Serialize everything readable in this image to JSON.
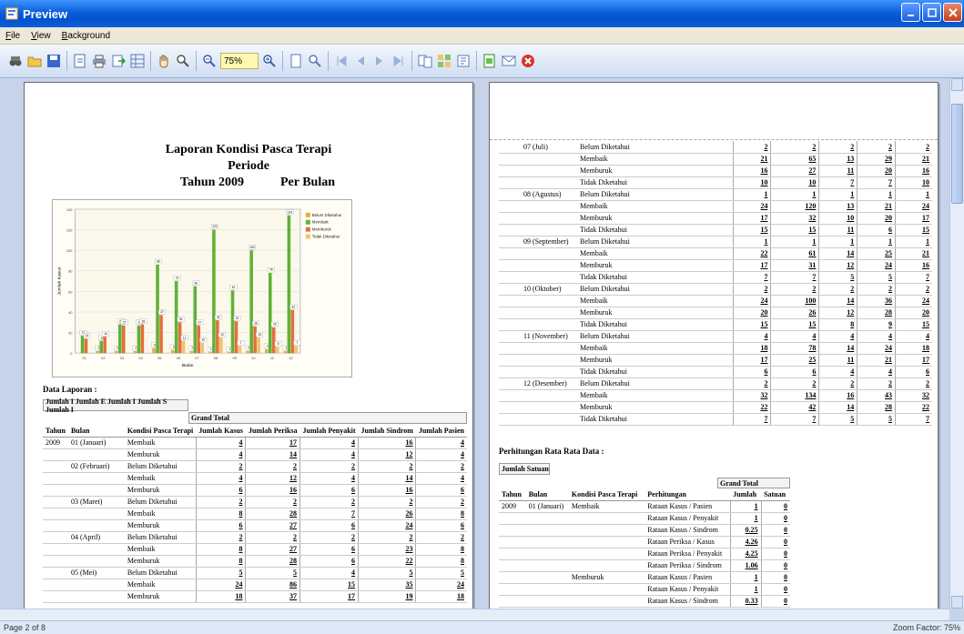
{
  "window": {
    "title": "Preview"
  },
  "menu": [
    "File",
    "View",
    "Background"
  ],
  "toolbar": {
    "zoom": "75%"
  },
  "status": {
    "page": "Page 2 of 8",
    "zoom": "Zoom Factor: 75%"
  },
  "report": {
    "title_line1": "Laporan Kondisi Pasca Terapi",
    "title_line2": "Periode",
    "title_year": "Tahun 2009",
    "title_per": "Per Bulan",
    "data_section": "Data Laporan :",
    "field_strip": "Jumlah I Jumlah E Jumlah I Jumlah S Jumlah I",
    "grand_total": "Grand Total",
    "columns": [
      "Tahun",
      "Bulan",
      "Kondisi Pasca Terapi",
      "Jumlah Kasus",
      "Jumlah Periksa",
      "Jumlah Penyakit",
      "Jumlah Sindrom",
      "Jumlah Pasien"
    ],
    "year": "2009",
    "rows": [
      {
        "month": "01 (Januari)",
        "kondisi": "Membaik",
        "v": [
          "4",
          "17",
          "4",
          "16",
          "4"
        ]
      },
      {
        "month": "",
        "kondisi": "Memburuk",
        "v": [
          "4",
          "14",
          "4",
          "12",
          "4"
        ]
      },
      {
        "month": "02 (Februari)",
        "kondisi": "Belum Diketahui",
        "v": [
          "2",
          "2",
          "2",
          "2",
          "2"
        ]
      },
      {
        "month": "",
        "kondisi": "Membaik",
        "v": [
          "4",
          "12",
          "4",
          "14",
          "4"
        ]
      },
      {
        "month": "",
        "kondisi": "Memburuk",
        "v": [
          "6",
          "16",
          "6",
          "16",
          "6"
        ]
      },
      {
        "month": "03 (Maret)",
        "kondisi": "Belum Diketahui",
        "v": [
          "2",
          "2",
          "2",
          "2",
          "2"
        ]
      },
      {
        "month": "",
        "kondisi": "Membaik",
        "v": [
          "8",
          "28",
          "7",
          "26",
          "8"
        ]
      },
      {
        "month": "",
        "kondisi": "Memburuk",
        "v": [
          "6",
          "27",
          "6",
          "24",
          "6"
        ]
      },
      {
        "month": "04 (April)",
        "kondisi": "Belum Diketahui",
        "v": [
          "2",
          "2",
          "2",
          "2",
          "2"
        ]
      },
      {
        "month": "",
        "kondisi": "Membaik",
        "v": [
          "8",
          "27",
          "6",
          "23",
          "8"
        ]
      },
      {
        "month": "",
        "kondisi": "Memburuk",
        "v": [
          "8",
          "28",
          "6",
          "22",
          "8"
        ]
      },
      {
        "month": "05 (Mei)",
        "kondisi": "Belum Diketahui",
        "v": [
          "5",
          "5",
          "4",
          "5",
          "5"
        ]
      },
      {
        "month": "",
        "kondisi": "Membaik",
        "v": [
          "24",
          "86",
          "15",
          "35",
          "24"
        ]
      },
      {
        "month": "",
        "kondisi": "Memburuk",
        "v": [
          "18",
          "37",
          "17",
          "19",
          "18"
        ]
      }
    ],
    "rows2": [
      {
        "month": "07 (Juli)",
        "kondisi": "Belum Diketahui",
        "v": [
          "2",
          "2",
          "2",
          "2",
          "2"
        ]
      },
      {
        "month": "",
        "kondisi": "Membaik",
        "v": [
          "21",
          "65",
          "13",
          "29",
          "21"
        ]
      },
      {
        "month": "",
        "kondisi": "Memburuk",
        "v": [
          "16",
          "27",
          "11",
          "20",
          "16"
        ]
      },
      {
        "month": "",
        "kondisi": "Tidak Diketahui",
        "v": [
          "10",
          "10",
          "7",
          "7",
          "10"
        ]
      },
      {
        "month": "08 (Agustus)",
        "kondisi": "Belum Diketahui",
        "v": [
          "1",
          "1",
          "1",
          "1",
          "1"
        ]
      },
      {
        "month": "",
        "kondisi": "Membaik",
        "v": [
          "24",
          "120",
          "13",
          "21",
          "24"
        ]
      },
      {
        "month": "",
        "kondisi": "Memburuk",
        "v": [
          "17",
          "32",
          "10",
          "20",
          "17"
        ]
      },
      {
        "month": "",
        "kondisi": "Tidak Diketahui",
        "v": [
          "15",
          "15",
          "11",
          "6",
          "15"
        ]
      },
      {
        "month": "09 (September)",
        "kondisi": "Belum Diketahui",
        "v": [
          "1",
          "1",
          "1",
          "1",
          "1"
        ]
      },
      {
        "month": "",
        "kondisi": "Membaik",
        "v": [
          "22",
          "61",
          "14",
          "25",
          "21"
        ]
      },
      {
        "month": "",
        "kondisi": "Memburuk",
        "v": [
          "17",
          "31",
          "12",
          "24",
          "16"
        ]
      },
      {
        "month": "",
        "kondisi": "Tidak Diketahui",
        "v": [
          "7",
          "7",
          "5",
          "5",
          "7"
        ]
      },
      {
        "month": "10 (Oktober)",
        "kondisi": "Belum Diketahui",
        "v": [
          "2",
          "2",
          "2",
          "2",
          "2"
        ]
      },
      {
        "month": "",
        "kondisi": "Membaik",
        "v": [
          "24",
          "100",
          "14",
          "36",
          "24"
        ]
      },
      {
        "month": "",
        "kondisi": "Memburuk",
        "v": [
          "20",
          "26",
          "12",
          "28",
          "20"
        ]
      },
      {
        "month": "",
        "kondisi": "Tidak Diketahui",
        "v": [
          "15",
          "15",
          "8",
          "9",
          "15"
        ]
      },
      {
        "month": "11 (November)",
        "kondisi": "Belum Diketahui",
        "v": [
          "4",
          "4",
          "4",
          "4",
          "4"
        ]
      },
      {
        "month": "",
        "kondisi": "Membaik",
        "v": [
          "18",
          "78",
          "14",
          "24",
          "18"
        ]
      },
      {
        "month": "",
        "kondisi": "Memburuk",
        "v": [
          "17",
          "25",
          "11",
          "21",
          "17"
        ]
      },
      {
        "month": "",
        "kondisi": "Tidak Diketahui",
        "v": [
          "6",
          "6",
          "4",
          "4",
          "6"
        ]
      },
      {
        "month": "12 (Desember)",
        "kondisi": "Belum Diketahui",
        "v": [
          "2",
          "2",
          "2",
          "2",
          "2"
        ]
      },
      {
        "month": "",
        "kondisi": "Membaik",
        "v": [
          "32",
          "134",
          "16",
          "43",
          "32"
        ]
      },
      {
        "month": "",
        "kondisi": "Memburuk",
        "v": [
          "22",
          "42",
          "14",
          "28",
          "22"
        ]
      },
      {
        "month": "",
        "kondisi": "Tidak Diketahui",
        "v": [
          "7",
          "7",
          "5",
          "5",
          "7"
        ]
      }
    ],
    "calc_section": "Perhitungan Rata Rata Data :",
    "calc_strip": "Jumlah  Satuan",
    "calc_columns": [
      "Tahun",
      "Bulan",
      "Kondisi Pasca Terapi",
      "Perhitungan",
      "Jumlah",
      "Satuan"
    ],
    "calc_rows": [
      {
        "year": "2009",
        "month": "01 (Januari)",
        "kondisi": "Membaik",
        "label": "Rataan Kasus / Pasien",
        "jumlah": "1",
        "satuan": "0"
      },
      {
        "year": "",
        "month": "",
        "kondisi": "",
        "label": "Rataan Kasus / Penyakit",
        "jumlah": "1",
        "satuan": "0"
      },
      {
        "year": "",
        "month": "",
        "kondisi": "",
        "label": "Rataan Kasus / Sindrom",
        "jumlah": "0.25",
        "satuan": "0"
      },
      {
        "year": "",
        "month": "",
        "kondisi": "",
        "label": "Rataan Periksa / Kasus",
        "jumlah": "4.26",
        "satuan": "0"
      },
      {
        "year": "",
        "month": "",
        "kondisi": "",
        "label": "Rataan Periksa / Penyakit",
        "jumlah": "4.25",
        "satuan": "0"
      },
      {
        "year": "",
        "month": "",
        "kondisi": "",
        "label": "Rataan Periksa / Sindrom",
        "jumlah": "1.06",
        "satuan": "0"
      },
      {
        "year": "",
        "month": "",
        "kondisi": "Memburuk",
        "label": "Rataan Kasus / Pasien",
        "jumlah": "1",
        "satuan": "0"
      },
      {
        "year": "",
        "month": "",
        "kondisi": "",
        "label": "Rataan Kasus / Penyakit",
        "jumlah": "1",
        "satuan": "0"
      },
      {
        "year": "",
        "month": "",
        "kondisi": "",
        "label": "Rataan Kasus / Sindrom",
        "jumlah": "0.33",
        "satuan": "0"
      }
    ]
  },
  "chart_data": {
    "type": "bar",
    "ylabel": "Jumlah Kasus",
    "xlabel": "Bulan",
    "legend_position": "top-right",
    "ylim": [
      0,
      140
    ],
    "categories": [
      "01",
      "02",
      "03",
      "04",
      "05",
      "06",
      "07",
      "08",
      "09",
      "10",
      "11",
      "12"
    ],
    "series": [
      {
        "name": "Belum Diketahui",
        "color": "#e8a94a",
        "values": [
          0,
          2,
          2,
          2,
          5,
          3,
          2,
          1,
          1,
          2,
          4,
          2
        ]
      },
      {
        "name": "Membaik",
        "color": "#5fb236",
        "values": [
          17,
          12,
          28,
          27,
          86,
          70,
          65,
          120,
          61,
          100,
          78,
          134
        ]
      },
      {
        "name": "Memburuk",
        "color": "#e2703a",
        "values": [
          14,
          16,
          27,
          28,
          37,
          30,
          27,
          32,
          31,
          26,
          25,
          42
        ]
      },
      {
        "name": "Tidak Diketahui",
        "color": "#f2c270",
        "values": [
          0,
          0,
          0,
          0,
          0,
          12,
          10,
          15,
          7,
          15,
          6,
          7
        ]
      }
    ]
  }
}
